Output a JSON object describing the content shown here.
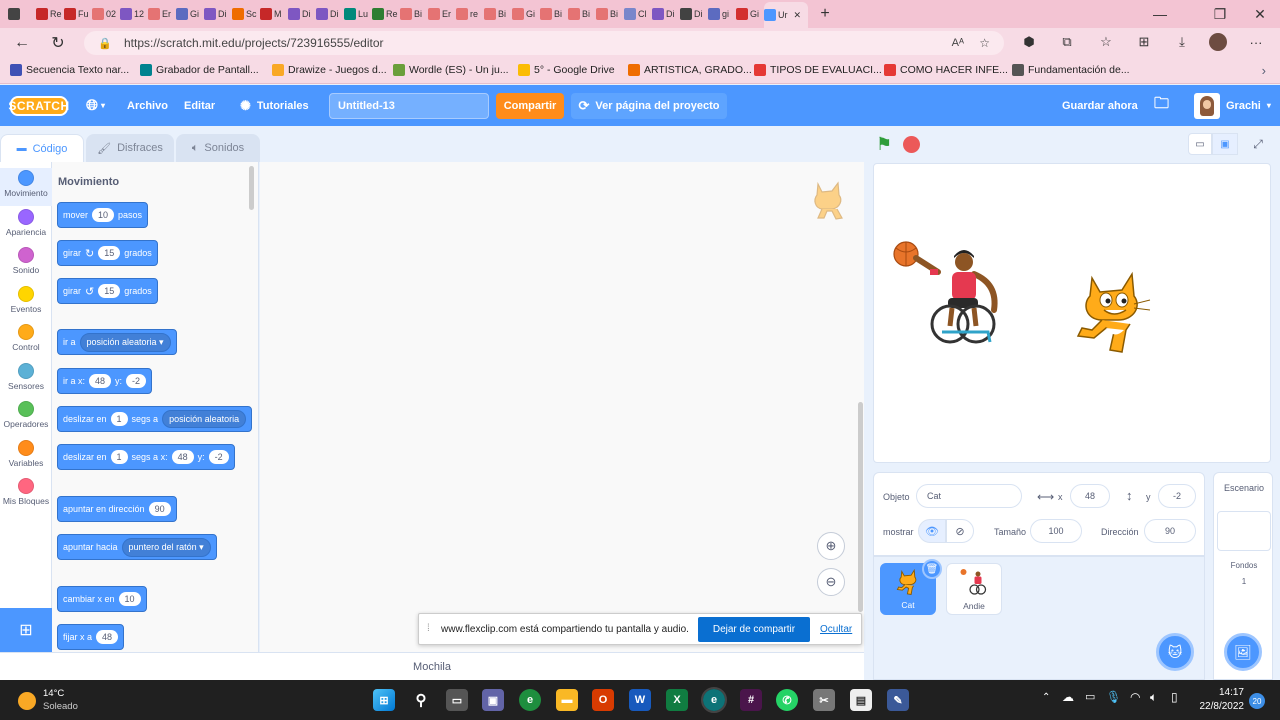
{
  "browser": {
    "tabs": [
      {
        "label": "",
        "color": "#444"
      },
      {
        "label": "Re",
        "color": "#c62828"
      },
      {
        "label": "Fu",
        "color": "#c62828"
      },
      {
        "label": "02",
        "color": "#e57373"
      },
      {
        "label": "12",
        "color": "#7e57c2"
      },
      {
        "label": "Er",
        "color": "#e57373"
      },
      {
        "label": "Gi",
        "color": "#5c6bc0"
      },
      {
        "label": "Di",
        "color": "#7e57c2"
      },
      {
        "label": "Sc",
        "color": "#ef6c00"
      },
      {
        "label": "M",
        "color": "#c62828"
      },
      {
        "label": "Di",
        "color": "#7e57c2"
      },
      {
        "label": "Di",
        "color": "#7e57c2"
      },
      {
        "label": "Lu",
        "color": "#00897b"
      },
      {
        "label": "Re",
        "color": "#2e7d32"
      },
      {
        "label": "Bi",
        "color": "#e57373"
      },
      {
        "label": "Er",
        "color": "#e57373"
      },
      {
        "label": "re",
        "color": "#e57373"
      },
      {
        "label": "Bi",
        "color": "#e57373"
      },
      {
        "label": "Gi",
        "color": "#e57373"
      },
      {
        "label": "Bi",
        "color": "#e57373"
      },
      {
        "label": "Bi",
        "color": "#e57373"
      },
      {
        "label": "Bi",
        "color": "#e57373"
      },
      {
        "label": "Cl",
        "color": "#7986cb"
      },
      {
        "label": "Di",
        "color": "#7e57c2"
      },
      {
        "label": "Di",
        "color": "#424242"
      },
      {
        "label": "gi",
        "color": "#5c6bc0"
      },
      {
        "label": "Gi",
        "color": "#d32f2f"
      }
    ],
    "active_tab": {
      "label": "Ur",
      "close": "✕"
    },
    "new_tab": "+",
    "url": "https://scratch.mit.edu/projects/723916555/editor",
    "bookmarks": [
      {
        "label": "Secuencia Texto nar...",
        "color": "#3f51b5"
      },
      {
        "label": "Grabador de Pantall...",
        "color": "#00838f"
      },
      {
        "label": "Drawize - Juegos d...",
        "color": "#f9a825"
      },
      {
        "label": "Wordle (ES) - Un ju...",
        "color": "#6a9f3a"
      },
      {
        "label": "5° - Google Drive",
        "color": "#fbbc04"
      },
      {
        "label": "ARTISTICA, GRADO...",
        "color": "#ef6c00"
      },
      {
        "label": "TIPOS DE EVALUACI...",
        "color": "#e53935"
      },
      {
        "label": "COMO HACER INFE...",
        "color": "#e53935"
      },
      {
        "label": "Fundamentación de...",
        "color": "#555555"
      }
    ]
  },
  "menu": {
    "logo": "SCRATCH",
    "archivo": "Archivo",
    "editar": "Editar",
    "tutoriales": "Tutoriales",
    "project_title": "Untitled-13",
    "share": "Compartir",
    "see_project": "Ver página del proyecto",
    "save_now": "Guardar ahora",
    "user": "Grachi"
  },
  "editor_tabs": {
    "code": "Código",
    "costumes": "Disfraces",
    "sounds": "Sonidos"
  },
  "categories": [
    {
      "label": "Movimiento",
      "color": "#4c97ff"
    },
    {
      "label": "Apariencia",
      "color": "#9966ff"
    },
    {
      "label": "Sonido",
      "color": "#cf63cf"
    },
    {
      "label": "Eventos",
      "color": "#ffd500"
    },
    {
      "label": "Control",
      "color": "#ffab19"
    },
    {
      "label": "Sensores",
      "color": "#5cb1d6"
    },
    {
      "label": "Operadores",
      "color": "#59c059"
    },
    {
      "label": "Variables",
      "color": "#ff8c1a"
    },
    {
      "label": "Mis Bloques",
      "color": "#ff6680"
    }
  ],
  "palette": {
    "heading": "Movimiento",
    "move": {
      "a": "mover",
      "v": "10",
      "b": "pasos"
    },
    "turn_right": {
      "a": "girar",
      "icon": "↻",
      "v": "15",
      "b": "grados"
    },
    "turn_left": {
      "a": "girar",
      "icon": "↺",
      "v": "15",
      "b": "grados"
    },
    "goto": {
      "a": "ir a",
      "dd": "posición aleatoria ▾"
    },
    "goto_xy": {
      "a": "ir a x:",
      "x": "48",
      "b": "y:",
      "y": "-2"
    },
    "glide": {
      "a": "deslizar en",
      "v": "1",
      "b": "segs a",
      "dd": "posición aleatoria"
    },
    "glide_xy": {
      "a": "deslizar en",
      "v": "1",
      "b": "segs a x:",
      "x": "48",
      "c": "y:",
      "y": "-2"
    },
    "point_dir": {
      "a": "apuntar en dirección",
      "v": "90"
    },
    "point_towards": {
      "a": "apuntar hacia",
      "dd": "puntero del ratón ▾"
    },
    "change_x": {
      "a": "cambiar x en",
      "v": "10"
    },
    "set_x": {
      "a": "fijar x a",
      "v": "48"
    }
  },
  "zoom": {
    "in": "+",
    "out": "−"
  },
  "backpack": "Mochila",
  "share_notice": {
    "text": "www.flexclip.com está compartiendo tu pantalla y audio.",
    "stop": "Dejar de compartir",
    "hide": "Ocultar"
  },
  "sprite_info": {
    "object_label": "Objeto",
    "object_value": "Cat",
    "x_label": "x",
    "x_value": "48",
    "y_label": "y",
    "y_value": "-2",
    "show_label": "mostrar",
    "size_label": "Tamaño",
    "size_value": "100",
    "direction_label": "Dirección",
    "direction_value": "90"
  },
  "sprites": [
    {
      "name": "Cat"
    },
    {
      "name": "Andie"
    }
  ],
  "stage_pane": {
    "title": "Escenario",
    "backdrops_label": "Fondos",
    "backdrops_count": "1"
  },
  "taskbar": {
    "weather_temp": "14°C",
    "weather_desc": "Soleado",
    "time": "14:17",
    "date": "22/8/2022",
    "badge": "20"
  }
}
